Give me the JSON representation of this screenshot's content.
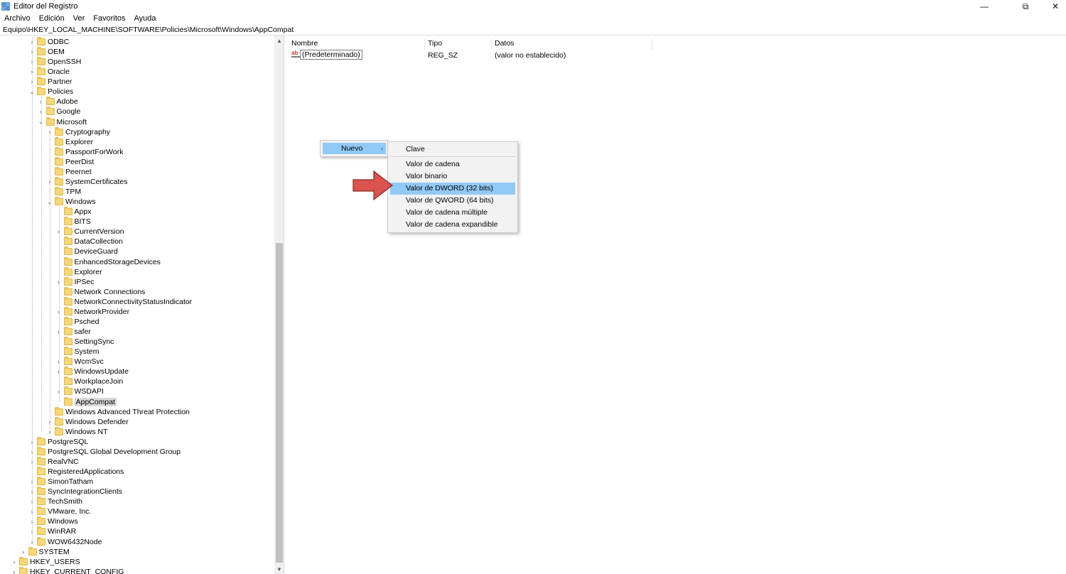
{
  "window": {
    "title": "Editor del Registro",
    "controls": {
      "minimize": "—",
      "maximize": "⧉",
      "close": "✕"
    }
  },
  "menu": [
    "Archivo",
    "Edición",
    "Ver",
    "Favoritos",
    "Ayuda"
  ],
  "address": "Equipo\\HKEY_LOCAL_MACHINE\\SOFTWARE\\Policies\\Microsoft\\Windows\\AppCompat",
  "tree": [
    {
      "label": "ODBC",
      "level": 3,
      "expander": "collapsed"
    },
    {
      "label": "OEM",
      "level": 3,
      "expander": "collapsed"
    },
    {
      "label": "OpenSSH",
      "level": 3,
      "expander": "collapsed"
    },
    {
      "label": "Oracle",
      "level": 3,
      "expander": "collapsed"
    },
    {
      "label": "Partner",
      "level": 3,
      "expander": "collapsed"
    },
    {
      "label": "Policies",
      "level": 3,
      "expander": "expanded"
    },
    {
      "label": "Adobe",
      "level": 4,
      "expander": "collapsed"
    },
    {
      "label": "Google",
      "level": 4,
      "expander": "collapsed"
    },
    {
      "label": "Microsoft",
      "level": 4,
      "expander": "expanded"
    },
    {
      "label": "Cryptography",
      "level": 5,
      "expander": "collapsed"
    },
    {
      "label": "Explorer",
      "level": 5,
      "expander": "none"
    },
    {
      "label": "PassportForWork",
      "level": 5,
      "expander": "none"
    },
    {
      "label": "PeerDist",
      "level": 5,
      "expander": "none"
    },
    {
      "label": "Peernet",
      "level": 5,
      "expander": "none"
    },
    {
      "label": "SystemCertificates",
      "level": 5,
      "expander": "collapsed"
    },
    {
      "label": "TPM",
      "level": 5,
      "expander": "none"
    },
    {
      "label": "Windows",
      "level": 5,
      "expander": "expanded"
    },
    {
      "label": "Appx",
      "level": 6,
      "expander": "none"
    },
    {
      "label": "BITS",
      "level": 6,
      "expander": "none"
    },
    {
      "label": "CurrentVersion",
      "level": 6,
      "expander": "collapsed"
    },
    {
      "label": "DataCollection",
      "level": 6,
      "expander": "none"
    },
    {
      "label": "DeviceGuard",
      "level": 6,
      "expander": "none"
    },
    {
      "label": "EnhancedStorageDevices",
      "level": 6,
      "expander": "none"
    },
    {
      "label": "Explorer",
      "level": 6,
      "expander": "none"
    },
    {
      "label": "IPSec",
      "level": 6,
      "expander": "collapsed"
    },
    {
      "label": "Network Connections",
      "level": 6,
      "expander": "none"
    },
    {
      "label": "NetworkConnectivityStatusIndicator",
      "level": 6,
      "expander": "none"
    },
    {
      "label": "NetworkProvider",
      "level": 6,
      "expander": "collapsed"
    },
    {
      "label": "Psched",
      "level": 6,
      "expander": "none"
    },
    {
      "label": "safer",
      "level": 6,
      "expander": "collapsed"
    },
    {
      "label": "SettingSync",
      "level": 6,
      "expander": "none"
    },
    {
      "label": "System",
      "level": 6,
      "expander": "none"
    },
    {
      "label": "WcmSvc",
      "level": 6,
      "expander": "collapsed"
    },
    {
      "label": "WindowsUpdate",
      "level": 6,
      "expander": "collapsed"
    },
    {
      "label": "WorkplaceJoin",
      "level": 6,
      "expander": "none"
    },
    {
      "label": "WSDAPI",
      "level": 6,
      "expander": "collapsed"
    },
    {
      "label": "AppCompat",
      "level": 6,
      "expander": "none",
      "selected": true
    },
    {
      "label": "Windows Advanced Threat Protection",
      "level": 5,
      "expander": "none"
    },
    {
      "label": "Windows Defender",
      "level": 5,
      "expander": "collapsed"
    },
    {
      "label": "Windows NT",
      "level": 5,
      "expander": "collapsed"
    },
    {
      "label": "PostgreSQL",
      "level": 3,
      "expander": "collapsed"
    },
    {
      "label": "PostgreSQL Global Development Group",
      "level": 3,
      "expander": "collapsed"
    },
    {
      "label": "RealVNC",
      "level": 3,
      "expander": "collapsed"
    },
    {
      "label": "RegisteredApplications",
      "level": 3,
      "expander": "none"
    },
    {
      "label": "SimonTatham",
      "level": 3,
      "expander": "collapsed"
    },
    {
      "label": "SyncIntegrationClients",
      "level": 3,
      "expander": "collapsed"
    },
    {
      "label": "TechSmith",
      "level": 3,
      "expander": "collapsed"
    },
    {
      "label": "VMware, Inc.",
      "level": 3,
      "expander": "collapsed"
    },
    {
      "label": "Windows",
      "level": 3,
      "expander": "collapsed"
    },
    {
      "label": "WinRAR",
      "level": 3,
      "expander": "collapsed"
    },
    {
      "label": "WOW6432Node",
      "level": 3,
      "expander": "collapsed"
    },
    {
      "label": "SYSTEM",
      "level": 2,
      "expander": "collapsed"
    },
    {
      "label": "HKEY_USERS",
      "level": 1,
      "expander": "collapsed"
    },
    {
      "label": "HKEY_CURRENT_CONFIG",
      "level": 1,
      "expander": "collapsed"
    }
  ],
  "columns": {
    "name": "Nombre",
    "type": "Tipo",
    "data": "Datos"
  },
  "values": [
    {
      "name": "(Predeterminado)",
      "type": "REG_SZ",
      "data": "(valor no establecido)",
      "icon": "string-value-icon"
    }
  ],
  "context_menu": {
    "item": "Nuevo",
    "submenu": [
      "Clave",
      "Valor de cadena",
      "Valor binario",
      "Valor de DWORD (32 bits)",
      "Valor de QWORD (64 bits)",
      "Valor de cadena múltiple",
      "Valor de cadena expandible"
    ],
    "highlighted": "Valor de DWORD (32 bits)"
  },
  "colors": {
    "highlight": "#91c9f7",
    "folder": "#f6d77b",
    "annotation_arrow": "#d9534f"
  }
}
